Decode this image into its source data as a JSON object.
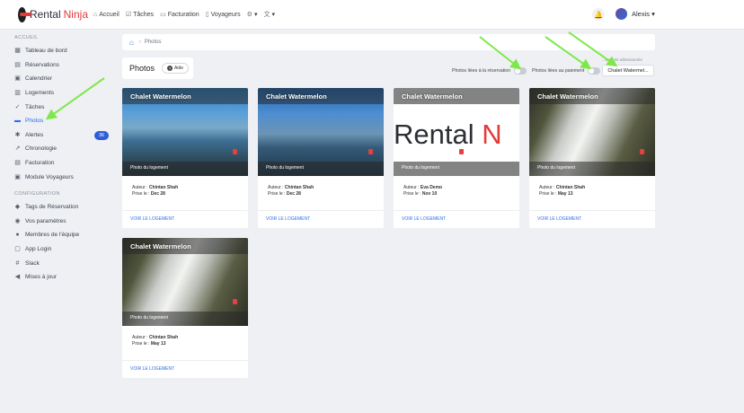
{
  "brand": {
    "name1": "Rental",
    "name2": "Ninja"
  },
  "topnav": {
    "items": [
      {
        "icon": "home-icon",
        "glyph": "⌂",
        "label": "Accueil"
      },
      {
        "icon": "checkbox-icon",
        "glyph": "☑",
        "label": "Tâches"
      },
      {
        "icon": "invoice-icon",
        "glyph": "▭",
        "label": "Facturation"
      },
      {
        "icon": "travelers-icon",
        "glyph": "▯",
        "label": "Voyageurs"
      },
      {
        "icon": "gear-icon",
        "glyph": "⚙",
        "label": "▾"
      },
      {
        "icon": "language-icon",
        "glyph": "文",
        "label": "▾"
      }
    ],
    "user": "Alexis ▾"
  },
  "sidebar": {
    "section1": "ACCUEIL",
    "items1": [
      {
        "label": "Tableau de bord",
        "glyph": "▦"
      },
      {
        "label": "Réservations",
        "glyph": "▤"
      },
      {
        "label": "Calendrier",
        "glyph": "▣"
      },
      {
        "label": "Logements",
        "glyph": "▥"
      },
      {
        "label": "Tâches",
        "glyph": "✓"
      },
      {
        "label": "Photos",
        "glyph": "▬"
      },
      {
        "label": "Alertes",
        "glyph": "✱"
      },
      {
        "label": "Chronologie",
        "glyph": "↗"
      },
      {
        "label": "Facturation",
        "glyph": "▤"
      },
      {
        "label": "Module Voyageurs",
        "glyph": "▣"
      }
    ],
    "alert_count": "36",
    "section2": "CONFIGURATION",
    "items2": [
      {
        "label": "Tags de Réservation",
        "glyph": "◆"
      },
      {
        "label": "Vos paramètres",
        "glyph": "◉"
      },
      {
        "label": "Membres de l'équipe",
        "glyph": "●"
      },
      {
        "label": "App Login",
        "glyph": "▢"
      },
      {
        "label": "Slack",
        "glyph": "#"
      },
      {
        "label": "Mises à jour",
        "glyph": "◀"
      }
    ]
  },
  "breadcrumb": {
    "current": "Photos"
  },
  "header": {
    "title": "Photos",
    "help": "Aide"
  },
  "filters": {
    "toggle1": "Photos liées à la réservation",
    "toggle2": "Photos liées au paiement",
    "selected_label": "...ements sélectionnés",
    "selected_value": "Chalet Watermel..."
  },
  "cards": [
    {
      "title": "Chalet Watermelon",
      "caption": "Photo du logement",
      "author_label": "Auteur :",
      "author": "Chintan Shah",
      "date_label": "Prise le :",
      "date": "Dec 28",
      "link": "VOIR LE LOGEMENT"
    },
    {
      "title": "Chalet Watermelon",
      "caption": "Photo du logement",
      "author_label": "Auteur :",
      "author": "Chintan Shah",
      "date_label": "Prise le :",
      "date": "Dec 28",
      "link": "VOIR LE LOGEMENT"
    },
    {
      "title": "Chalet Watermelon",
      "caption": "Photo du logement",
      "author_label": "Auteur :",
      "author": "Eva Demo",
      "date_label": "Prise le :",
      "date": "Nov 10",
      "link": "VOIR LE LOGEMENT",
      "logo1": "Rental",
      "logo2": "N"
    },
    {
      "title": "Chalet Watermelon",
      "caption": "Photo du logement",
      "author_label": "Auteur :",
      "author": "Chintan Shah",
      "date_label": "Prise le :",
      "date": "May 13",
      "link": "VOIR LE LOGEMENT"
    },
    {
      "title": "Chalet Watermelon",
      "caption": "Photo du logement",
      "author_label": "Auteur :",
      "author": "Chintan Shah",
      "date_label": "Prise le :",
      "date": "May 13",
      "link": "VOIR LE LOGEMENT"
    }
  ],
  "colors": {
    "accent": "#2f6fe4",
    "badge": "#2f5fd7",
    "brand_red": "#e43a3a",
    "arrow": "#7ee84a"
  }
}
